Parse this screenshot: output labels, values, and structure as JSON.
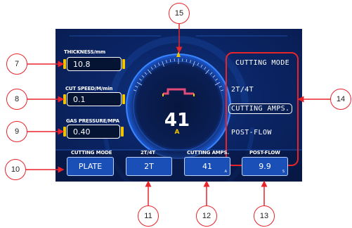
{
  "left_panel": {
    "thickness_label": "THICKNESS/mm",
    "thickness_value": "10.8",
    "cut_speed_label": "CUT SPEED/M/min",
    "cut_speed_value": "0.1",
    "gas_pressure_label": "GAS PRESSURE/MPA",
    "gas_pressure_value": "0.40"
  },
  "gauge": {
    "value": "41",
    "unit": "A"
  },
  "menu": {
    "items": [
      {
        "label": "CUTTING MODE",
        "selected": false
      },
      {
        "label": "2T/4T",
        "selected": false
      },
      {
        "label": "CUTTING AMPS.",
        "selected": true
      },
      {
        "label": "POST-FLOW",
        "selected": false
      }
    ]
  },
  "bottom_bar": {
    "items": [
      {
        "header": "CUTTING MODE",
        "value": "PLATE",
        "unit": ""
      },
      {
        "header": "2T/4T",
        "value": "2T",
        "unit": ""
      },
      {
        "header": "CUTTING AMPS.",
        "value": "41",
        "unit": "A"
      },
      {
        "header": "POST-FLOW",
        "value": "9.9",
        "unit": "S"
      }
    ]
  },
  "callouts": [
    "7",
    "8",
    "9",
    "10",
    "11",
    "12",
    "13",
    "14",
    "15"
  ],
  "colors": {
    "screen_bg": "#0b2566",
    "accent_yellow": "#f2c500",
    "callout_red": "#e8242b",
    "button_blue": "#1a4fb8"
  }
}
